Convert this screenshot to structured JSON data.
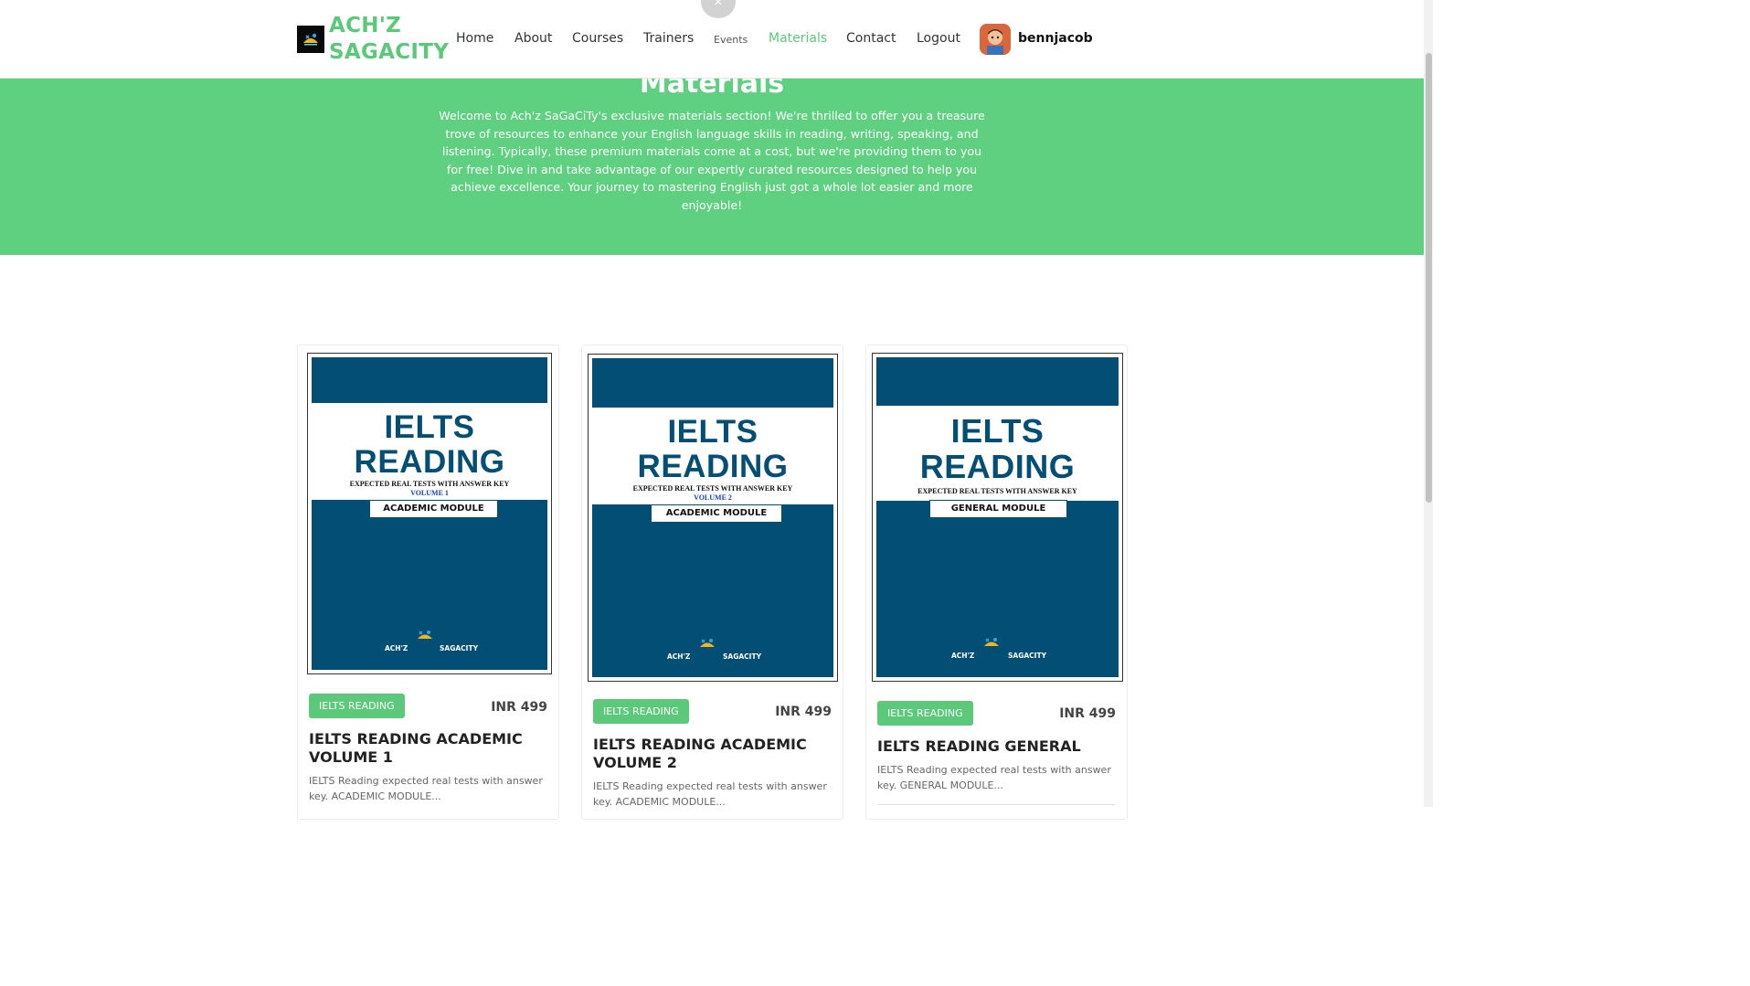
{
  "brand": {
    "name_line1": "ACH'Z",
    "name_line2": "SAGACITY",
    "accent_color": "#5cc97a"
  },
  "nav": {
    "items": [
      {
        "label": "Home"
      },
      {
        "label": "About"
      },
      {
        "label": "Courses"
      },
      {
        "label": "Trainers"
      },
      {
        "label": "Events"
      },
      {
        "label": "Materials",
        "active": true
      },
      {
        "label": "Contact"
      },
      {
        "label": "Logout"
      }
    ],
    "username": "bennjacob"
  },
  "close_icon": "×",
  "hero": {
    "title": "Materials",
    "text": "Welcome to Ach'z SaGaCiTy's exclusive materials section! We're thrilled to offer you a treasure trove of resources to enhance your English language skills in reading, writing, speaking, and listening. Typically, these premium materials come at a cost, but we're providing them to you for free! Dive in and take advantage of our expertly curated resources designed to help you achieve excellence. Your journey to mastering English just got a whole lot easier and more enjoyable!",
    "background": "#5fd07f"
  },
  "cards": [
    {
      "cover": {
        "line1": "IELTS",
        "line2": "READING",
        "subtitle": "EXPECTED REAL TESTS WITH ANSWER KEY",
        "volume": "VOLUME 1",
        "module": "ACADEMIC MODULE",
        "brand_left": "ACH'Z",
        "brand_right": "SAGACITY"
      },
      "tag": "IELTS READING",
      "price": "INR 499",
      "title": "IELTS READING ACADEMIC VOLUME 1",
      "description": "IELTS Reading expected real tests with answer key. ACADEMIC MODULE..."
    },
    {
      "cover": {
        "line1": "IELTS",
        "line2": "READING",
        "subtitle": "EXPECTED REAL TESTS WITH ANSWER KEY",
        "volume": "VOLUME 2",
        "module": "ACADEMIC MODULE",
        "brand_left": "ACH'Z",
        "brand_right": "SAGACITY"
      },
      "tag": "IELTS READING",
      "price": "INR 499",
      "title": "IELTS READING ACADEMIC VOLUME 2",
      "description": "IELTS Reading expected real tests with answer key. ACADEMIC MODULE..."
    },
    {
      "cover": {
        "line1": "IELTS",
        "line2": "READING",
        "subtitle": "EXPECTED REAL TESTS WITH ANSWER KEY",
        "volume": "",
        "module": "GENERAL MODULE",
        "brand_left": "ACH'Z",
        "brand_right": "SAGACITY"
      },
      "tag": "IELTS READING",
      "price": "INR 499",
      "title": "IELTS READING GENERAL",
      "description": "IELTS Reading expected real tests with answer key. GENERAL MODULE..."
    }
  ]
}
